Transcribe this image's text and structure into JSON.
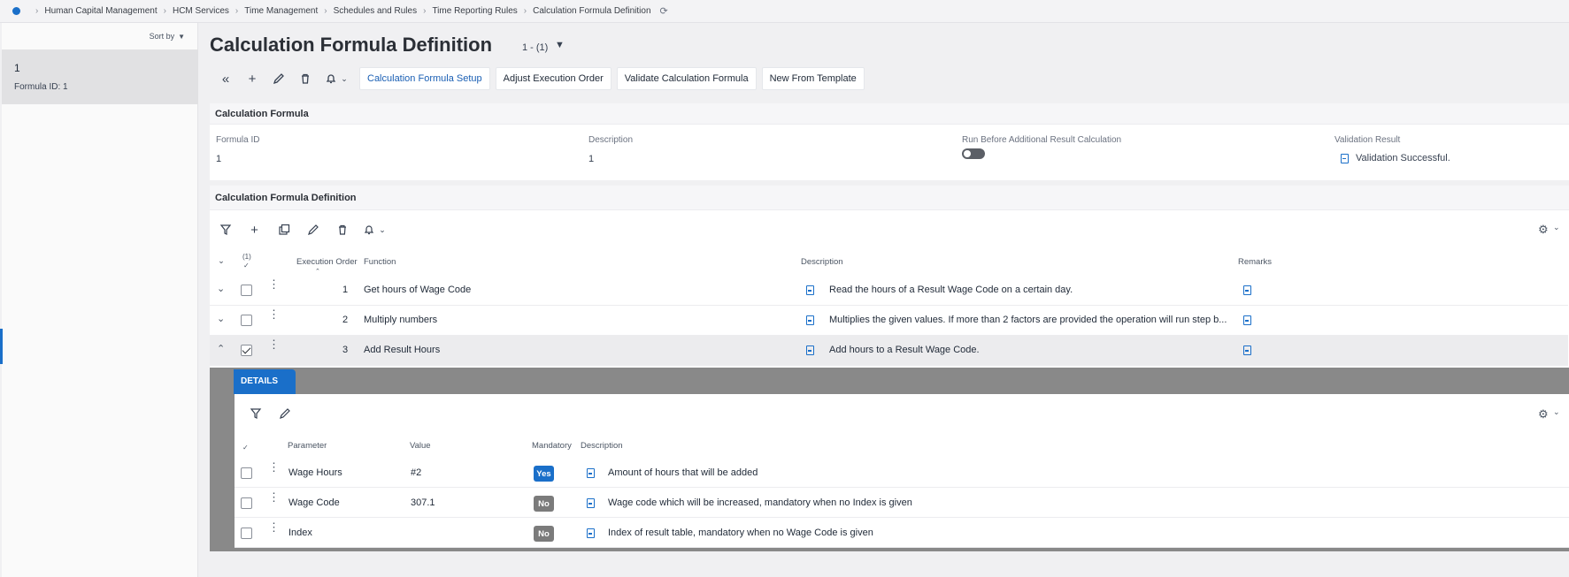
{
  "breadcrumb": [
    "Human Capital Management",
    "HCM Services",
    "Time Management",
    "Schedules and Rules",
    "Time Reporting Rules",
    "Calculation Formula Definition"
  ],
  "sidebar": {
    "sort_label": "Sort by",
    "item": {
      "id": "1",
      "subtitle": "Formula ID:  1"
    }
  },
  "page": {
    "title": "Calculation Formula Definition",
    "counter": "1 - (1)"
  },
  "toolbar": {
    "buttons": [
      "Calculation Formula Setup",
      "Adjust Execution Order",
      "Validate Calculation Formula",
      "New From Template"
    ]
  },
  "formula_panel": {
    "title": "Calculation Formula",
    "fields": {
      "formula_id_label": "Formula ID",
      "formula_id_value": "1",
      "description_label": "Description",
      "description_value": "1",
      "run_before_label": "Run Before Additional Result Calculation",
      "validation_label": "Validation Result",
      "validation_value": "Validation Successful."
    }
  },
  "definition_panel": {
    "title": "Calculation Formula Definition",
    "columns": {
      "selected_count": "(1)",
      "execution_order": "Execution Order",
      "function": "Function",
      "description": "Description",
      "remarks": "Remarks"
    },
    "rows": [
      {
        "order": "1",
        "function": "Get hours of Wage Code",
        "description": "Read the hours of a Result Wage Code on a certain day.",
        "checked": false,
        "expanded": false
      },
      {
        "order": "2",
        "function": "Multiply numbers",
        "description": "Multiplies the given values. If more than 2 factors are provided the operation will run step b...",
        "checked": false,
        "expanded": false
      },
      {
        "order": "3",
        "function": "Add Result Hours",
        "description": "Add hours to a Result Wage Code.",
        "checked": true,
        "expanded": true
      }
    ]
  },
  "details": {
    "tab_label": "DETAILS",
    "columns": {
      "parameter": "Parameter",
      "value": "Value",
      "mandatory": "Mandatory",
      "description": "Description"
    },
    "rows": [
      {
        "parameter": "Wage Hours",
        "value": "#2",
        "mandatory": "Yes",
        "description": "Amount of hours that will be added"
      },
      {
        "parameter": "Wage Code",
        "value": "307.1",
        "mandatory": "No",
        "description": "Wage code which will be increased, mandatory when no Index is given"
      },
      {
        "parameter": "Index",
        "value": "",
        "mandatory": "No",
        "description": "Index of result table, mandatory when no Wage Code is given"
      }
    ]
  },
  "colors": {
    "accent": "#1a6fc9",
    "mandatory_yes": "#1a6fc9",
    "mandatory_no": "#7b7b7b"
  }
}
